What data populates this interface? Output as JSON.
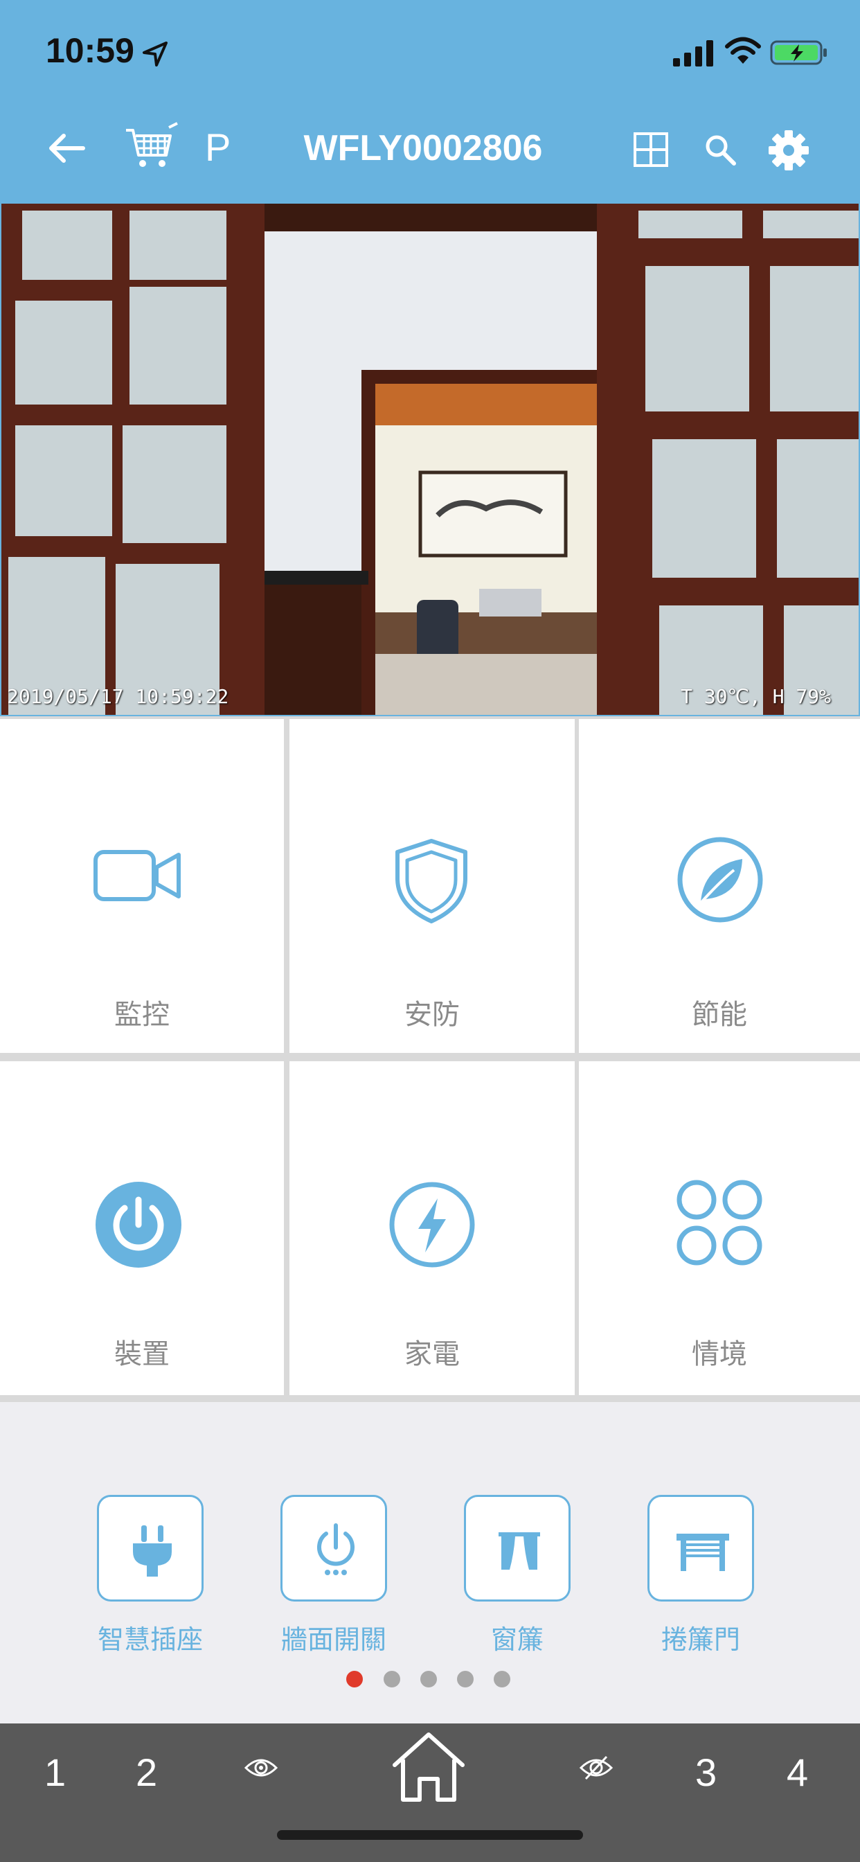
{
  "status_bar": {
    "time": "10:59"
  },
  "nav": {
    "title": "WFLY0002806",
    "p_label": "P"
  },
  "camera": {
    "timestamp": "2019/05/17 10:59:22",
    "environment": "T 30℃, H 79%"
  },
  "categories": [
    {
      "label": "監控",
      "icon": "video-camera-icon"
    },
    {
      "label": "安防",
      "icon": "shield-icon"
    },
    {
      "label": "節能",
      "icon": "leaf-icon"
    },
    {
      "label": "裝置",
      "icon": "power-icon"
    },
    {
      "label": "家電",
      "icon": "lightning-icon"
    },
    {
      "label": "情境",
      "icon": "four-circles-icon"
    }
  ],
  "shortcuts": [
    {
      "label": "智慧插座",
      "icon": "plug-icon"
    },
    {
      "label": "牆面開關",
      "icon": "wall-switch-icon"
    },
    {
      "label": "窗簾",
      "icon": "curtain-icon"
    },
    {
      "label": "捲簾門",
      "icon": "rolling-door-icon"
    }
  ],
  "pager": {
    "count": 5,
    "active": 1
  },
  "bottom_bar": {
    "item1": "1",
    "item2": "2",
    "item3": "3",
    "item4": "4"
  },
  "colors": {
    "accent": "#68b3df",
    "bottom_bar": "#595959",
    "active_dot": "#e03a2b"
  }
}
